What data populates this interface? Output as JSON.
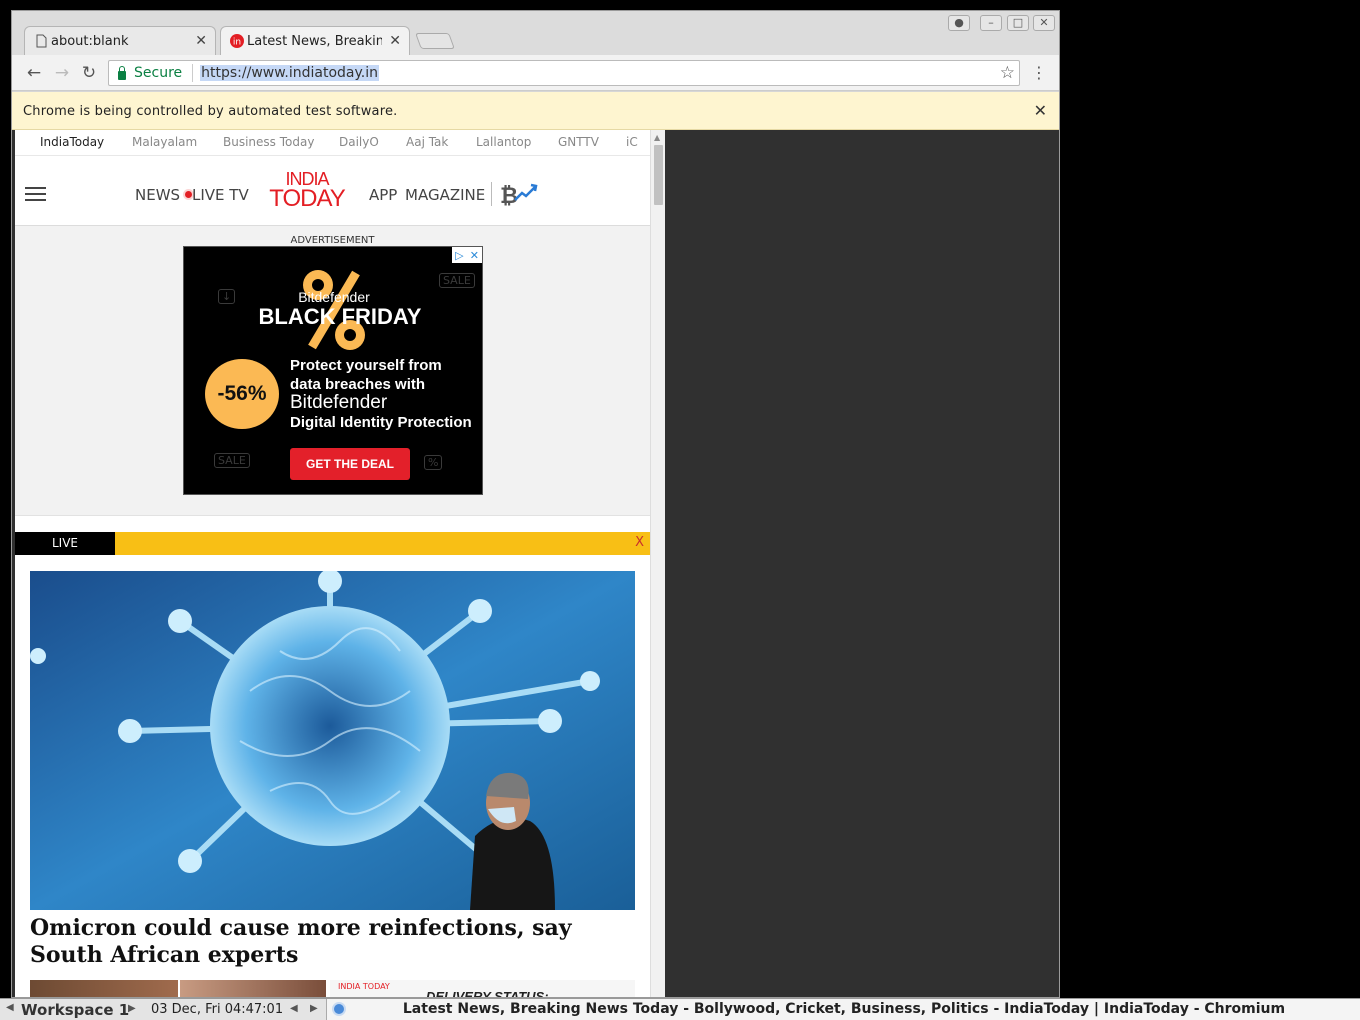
{
  "browser": {
    "tabs": [
      {
        "title": "about:blank"
      },
      {
        "title": "Latest News, Breaking News Today"
      }
    ],
    "secure_label": "Secure",
    "url": "https://www.indiatoday.in",
    "infobar_text": "Chrome is being controlled by automated test software.",
    "icons": [
      "back-icon",
      "forward-icon",
      "reload-icon",
      "lock-icon",
      "star-icon",
      "menu-icon",
      "close-icon"
    ]
  },
  "site": {
    "network_links": [
      "IndiaToday",
      "Malayalam",
      "Business Today",
      "DailyO",
      "Aaj Tak",
      "Lallantop",
      "GNTTV",
      "iC"
    ],
    "nav": {
      "news": "NEWS",
      "live_tv": "LIVE TV",
      "app": "APP",
      "magazine": "MAGAZINE"
    },
    "logo": {
      "line1": "INDIA",
      "line2": "TODAY"
    },
    "brand_color": "#e31e24",
    "advertisement_label": "ADVERTISEMENT",
    "ad": {
      "brand": "Bitdefender",
      "headline": "BLACK FRIDAY",
      "discount": "-56%",
      "copy_line1": "Protect yourself from",
      "copy_line2": "data breaches with",
      "brand2": "Bitdefender",
      "copy_line3": "Digital Identity Protection",
      "cta": "GET THE DEAL",
      "deco1": "SALE",
      "deco2": "SALE"
    },
    "live_label": "LIVE",
    "live_close": "X",
    "headline": "Omicron could cause more reinfections, say South African experts",
    "thumb_logo": "INDIA TODAY",
    "thumb_text": "DELIVERY STATUS:"
  },
  "taskbar": {
    "workspace": "Workspace 1",
    "clock": "03 Dec, Fri 04:47:01",
    "window_title": "Latest News, Breaking News Today - Bollywood, Cricket, Business, Politics - IndiaToday | IndiaToday - Chromium"
  }
}
